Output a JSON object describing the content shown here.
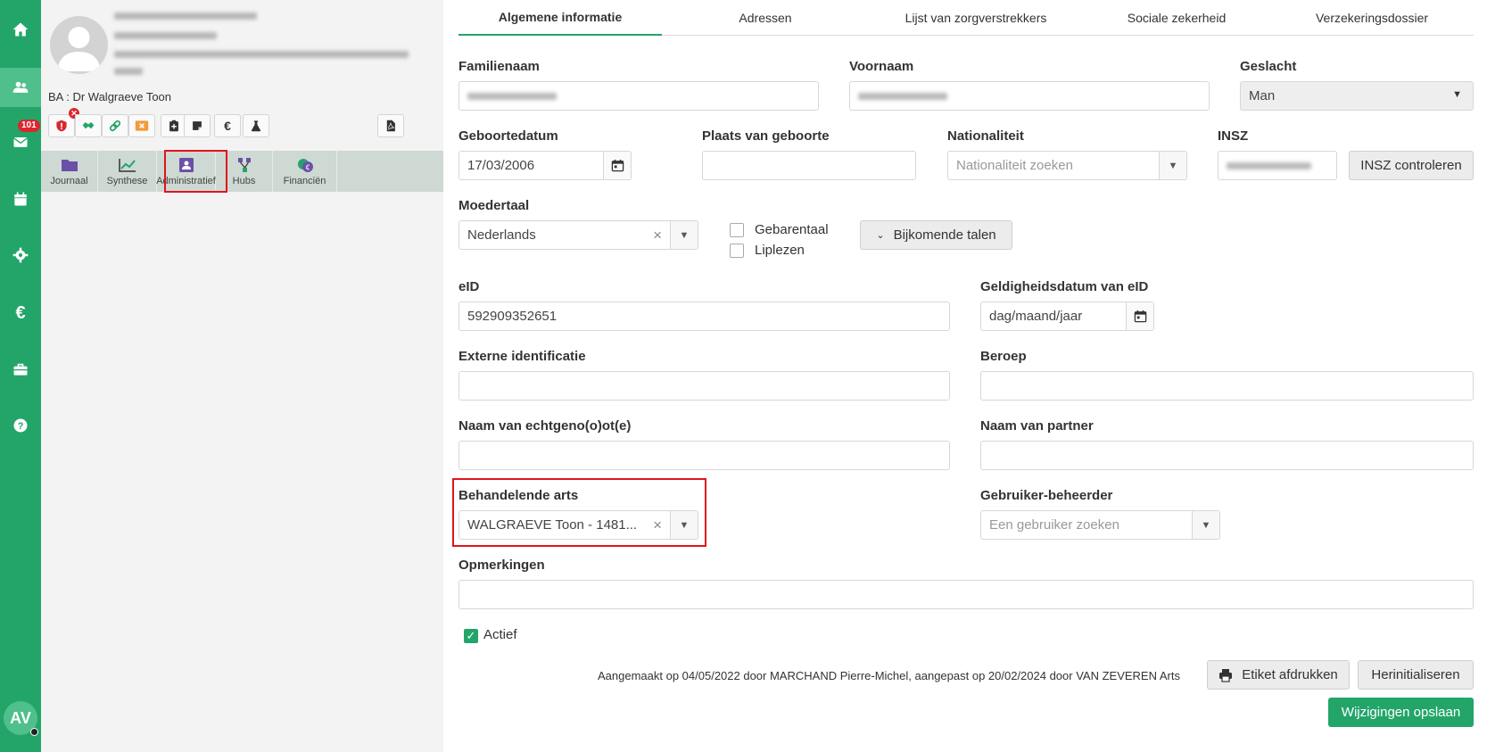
{
  "nav": {
    "items": [
      {
        "name": "home-icon"
      },
      {
        "name": "users-icon",
        "active": true
      },
      {
        "name": "mail-icon",
        "badge": "101"
      },
      {
        "name": "calendar-icon"
      },
      {
        "name": "gear-icon"
      },
      {
        "name": "euro-icon"
      },
      {
        "name": "briefcase-icon"
      },
      {
        "name": "help-icon"
      }
    ],
    "user_initials": "AV"
  },
  "patient": {
    "ba_label": "BA : Dr Walgraeve Toon",
    "action_icons": [
      "shield-alert-icon",
      "handshake-icon",
      "link-icon",
      "dismiss-icon",
      "clipboard-icon",
      "note-icon",
      "euro-icon",
      "flask-icon",
      "pdf-icon"
    ],
    "action_glyphs": {
      "euro": "€"
    }
  },
  "sub_tabs": [
    {
      "label": "Journaal",
      "icon": "folder-icon"
    },
    {
      "label": "Synthese",
      "icon": "chart-icon"
    },
    {
      "label": "Administratief",
      "icon": "id-card-icon",
      "highlighted": true
    },
    {
      "label": "Hubs",
      "icon": "hubs-icon"
    },
    {
      "label": "Financiën",
      "icon": "finance-icon"
    }
  ],
  "tabs": [
    {
      "label": "Algemene informatie",
      "active": true
    },
    {
      "label": "Adressen"
    },
    {
      "label": "Lijst van zorgverstrekkers"
    },
    {
      "label": "Sociale zekerheid"
    },
    {
      "label": "Verzekeringsdossier"
    }
  ],
  "form": {
    "familienaam_label": "Familienaam",
    "voornaam_label": "Voornaam",
    "geslacht_label": "Geslacht",
    "geslacht_value": "Man",
    "geboortedatum_label": "Geboortedatum",
    "geboortedatum_value": "17/03/2006",
    "plaats_label": "Plaats van geboorte",
    "nationaliteit_label": "Nationaliteit",
    "nationaliteit_placeholder": "Nationaliteit zoeken",
    "insz_label": "INSZ",
    "insz_button": "INSZ controleren",
    "moedertaal_label": "Moedertaal",
    "moedertaal_value": "Nederlands",
    "gebarentaal_label": "Gebarentaal",
    "liplezen_label": "Liplezen",
    "bijkomende_button": "Bijkomende talen",
    "eid_label": "eID",
    "eid_value": "592909352651",
    "eid_validity_label": "Geldigheidsdatum van eID",
    "eid_validity_placeholder": "dag/maand/jaar",
    "externe_label": "Externe identificatie",
    "beroep_label": "Beroep",
    "echtgenoot_label": "Naam van echtgeno(o)ot(e)",
    "partner_label": "Naam van partner",
    "behandelende_label": "Behandelende arts",
    "behandelende_value": "WALGRAEVE Toon - 1481...",
    "beheerder_label": "Gebruiker-beheerder",
    "beheerder_placeholder": "Een gebruiker zoeken",
    "opmerkingen_label": "Opmerkingen",
    "actief_label": "Actief",
    "actief_checked": true
  },
  "footer": {
    "meta_text": "Aangemaakt op 04/05/2022 door MARCHAND Pierre-Michel, aangepast op 20/02/2024 door VAN ZEVEREN Arts",
    "print_button": "Etiket afdrukken",
    "reset_button": "Herinitialiseren",
    "save_button": "Wijzigingen opslaan"
  },
  "colors": {
    "brand": "#23a56a",
    "highlight": "#e0141e",
    "nav_active": "#4fbf8c"
  }
}
